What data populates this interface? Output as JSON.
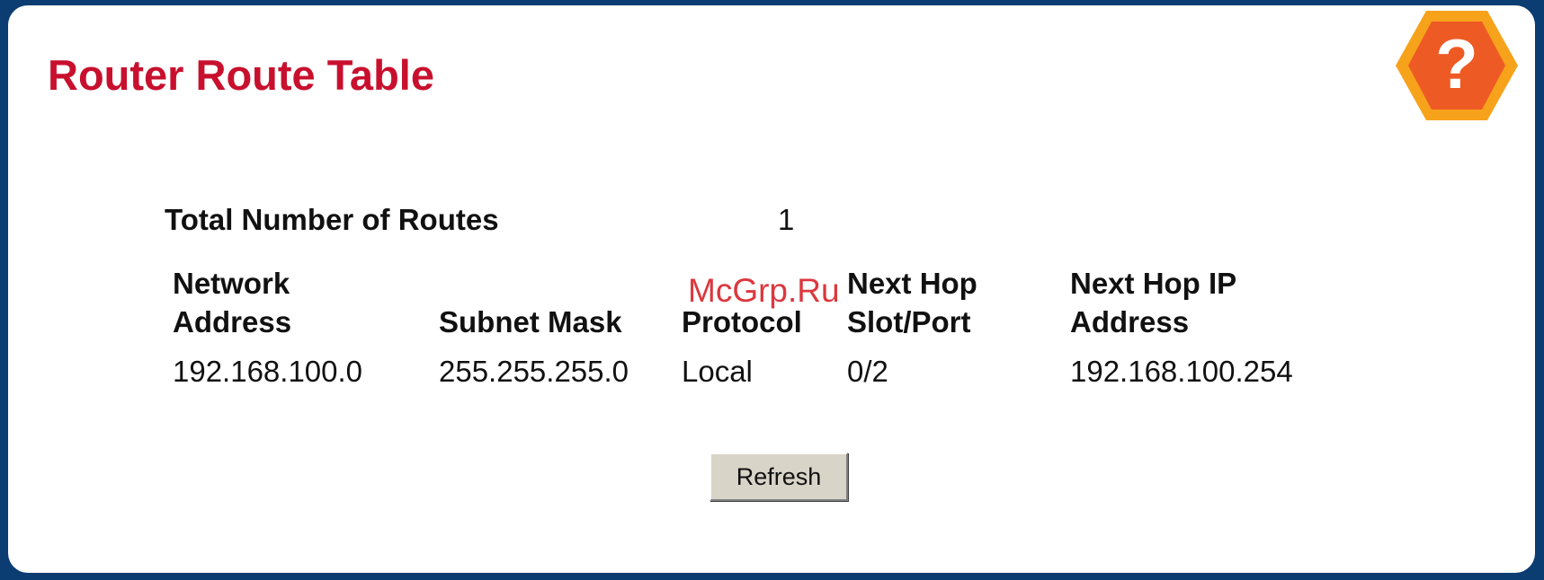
{
  "page": {
    "title": "Router Route Table"
  },
  "help": {
    "icon": "question-mark-hexagon-icon",
    "glyph": "?",
    "colors": {
      "outer": "#f7a21b",
      "inner": "#ee5a24",
      "glyph": "#ffffff"
    }
  },
  "summary": {
    "label": "Total Number of Routes",
    "value": "1"
  },
  "table": {
    "headers": [
      [
        "Network",
        "Address"
      ],
      [
        "",
        "Subnet Mask"
      ],
      [
        "",
        "Protocol"
      ],
      [
        "Next Hop",
        "Slot/Port"
      ],
      [
        "Next Hop IP",
        "Address"
      ]
    ],
    "rows": [
      [
        "192.168.100.0",
        "255.255.255.0",
        "Local",
        "0/2",
        "192.168.100.254"
      ]
    ]
  },
  "actions": {
    "refresh_label": "Refresh"
  },
  "watermark": {
    "text": "McGrp.Ru"
  },
  "colors": {
    "frame": "#0b3d73",
    "title": "#c8102e",
    "button_face": "#d8d4c8"
  }
}
